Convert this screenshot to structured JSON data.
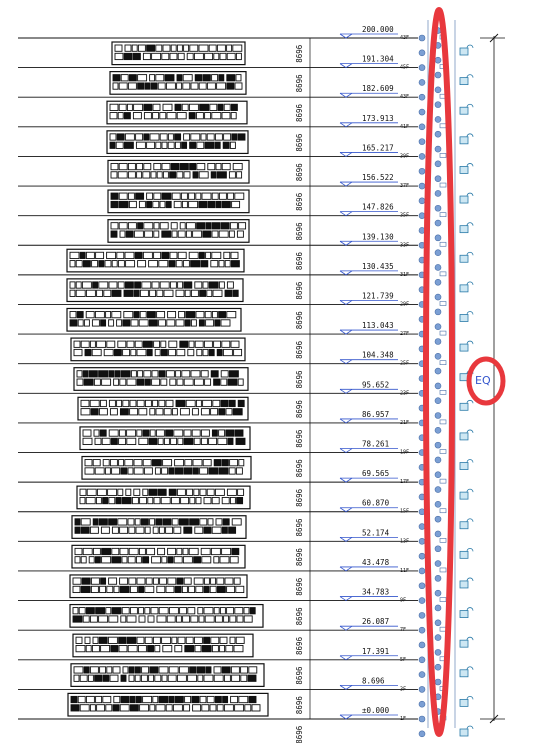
{
  "floors": [
    {
      "elevation": "200.000",
      "level": "43F"
    },
    {
      "elevation": "191.304",
      "level": "45F"
    },
    {
      "elevation": "182.609",
      "level": "43F"
    },
    {
      "elevation": "173.913",
      "level": "41F"
    },
    {
      "elevation": "165.217",
      "level": "39F"
    },
    {
      "elevation": "156.522",
      "level": "37F"
    },
    {
      "elevation": "147.826",
      "level": "35F"
    },
    {
      "elevation": "139.130",
      "level": "33F"
    },
    {
      "elevation": "130.435",
      "level": "31F"
    },
    {
      "elevation": "121.739",
      "level": "29F"
    },
    {
      "elevation": "113.043",
      "level": "27F"
    },
    {
      "elevation": "104.348",
      "level": "25F"
    },
    {
      "elevation": "95.652",
      "level": "23F"
    },
    {
      "elevation": "86.957",
      "level": "21F"
    },
    {
      "elevation": "78.261",
      "level": "19F"
    },
    {
      "elevation": "69.565",
      "level": "17F"
    },
    {
      "elevation": "60.870",
      "level": "15F"
    },
    {
      "elevation": "52.174",
      "level": "13F"
    },
    {
      "elevation": "43.478",
      "level": "11F"
    },
    {
      "elevation": "34.783",
      "level": "9F"
    },
    {
      "elevation": "26.087",
      "level": "7F"
    },
    {
      "elevation": "17.391",
      "level": "5F"
    },
    {
      "elevation": "8.696",
      "level": "3F"
    },
    {
      "elevation": "±0.000",
      "level": "1F"
    }
  ],
  "floor_height_label": "8696",
  "eq_label": "EQ",
  "colors": {
    "highlight": "#e8383d",
    "node": "#7b9fd4",
    "accent": "#3355cc",
    "line": "#111111"
  }
}
